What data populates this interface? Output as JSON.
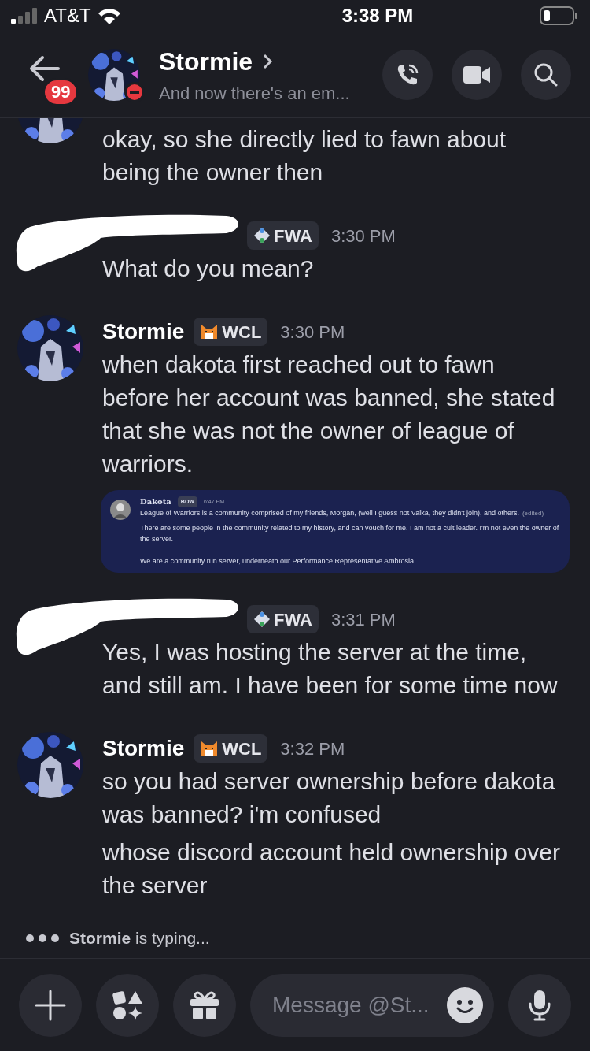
{
  "status_bar": {
    "carrier": "AT&T",
    "time": "3:38 PM"
  },
  "header": {
    "badge": "99",
    "name": "Stormie",
    "subtitle": "And now there's an em..."
  },
  "messages": [
    {
      "kind": "continued",
      "lines": [
        "okay, so she directly lied to fawn about being the owner then"
      ]
    },
    {
      "kind": "redacted",
      "tag": {
        "kind": "diamond",
        "label": "FWA"
      },
      "time": "3:30 PM",
      "lines": [
        "What do you mean?"
      ]
    },
    {
      "kind": "full",
      "author": "Stormie",
      "tag": {
        "kind": "cat",
        "label": "WCL"
      },
      "time": "3:30 PM",
      "lines": [
        "when dakota first reached out to fawn before her account was banned, she stated that she was not the owner of league of warriors."
      ],
      "embed": {
        "author": "Dakota",
        "tag": "BOW",
        "time": "6:47 PM",
        "paragraphs": [
          "League of Warriors is a community comprised of my friends, Morgan, (well I guess not Valka, they didn't join), and others.",
          "There are some people in the community related to my history, and can vouch for me. I am not a cult leader. I'm not even the owner of the server.",
          "We are a community run server, underneath our Performance Representative Ambrosia."
        ],
        "edited": "(edited)"
      }
    },
    {
      "kind": "redacted",
      "tag": {
        "kind": "diamond",
        "label": "FWA"
      },
      "time": "3:31 PM",
      "lines": [
        "Yes, I was hosting the server at the time, and still am. I have been for some time now"
      ]
    },
    {
      "kind": "full",
      "author": "Stormie",
      "tag": {
        "kind": "cat",
        "label": "WCL"
      },
      "time": "3:32 PM",
      "lines": [
        "so you had server ownership before dakota was banned? i'm confused",
        "whose discord account held ownership over the server"
      ]
    }
  ],
  "typing": "**Stormie** is typing...",
  "composer": {
    "placeholder": "Message @St..."
  }
}
